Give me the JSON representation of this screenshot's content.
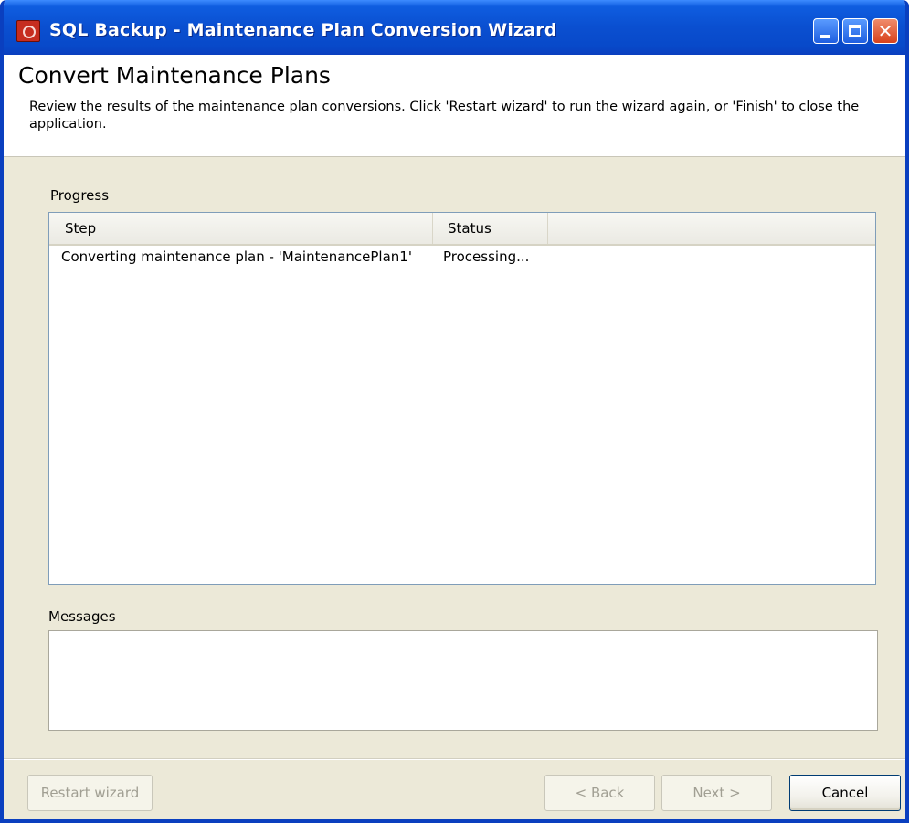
{
  "window": {
    "title": "SQL Backup - Maintenance Plan Conversion Wizard",
    "controls": {
      "minimize": "minimize",
      "maximize": "maximize",
      "close": "✕"
    }
  },
  "header": {
    "title": "Convert Maintenance Plans",
    "description": "Review the results of the maintenance plan conversions.  Click 'Restart wizard' to run the wizard again, or 'Finish' to close the application."
  },
  "progress": {
    "label": "Progress",
    "columns": [
      "Step",
      "Status"
    ],
    "rows": [
      {
        "step": "Converting maintenance plan - 'MaintenancePlan1'",
        "status": "Processing..."
      }
    ]
  },
  "messages": {
    "label": "Messages",
    "content": ""
  },
  "buttons": {
    "restart": "Restart wizard",
    "back": "< Back",
    "next": "Next >",
    "cancel": "Cancel"
  },
  "colors": {
    "titlebar": "#0a4fd0",
    "window_bg": "#ece9d8",
    "list_border": "#7f9db9"
  }
}
